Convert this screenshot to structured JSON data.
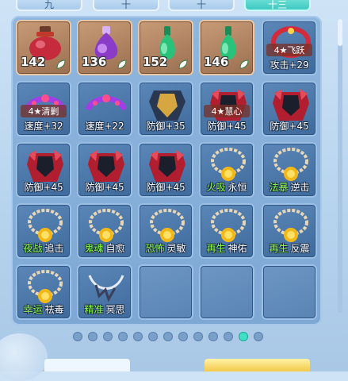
{
  "tabs": [
    {
      "label": "九",
      "active": false
    },
    {
      "label": "十",
      "active": false
    },
    {
      "label": "十",
      "active": false
    },
    {
      "label": "十三",
      "active": true
    }
  ],
  "row1": [
    {
      "kind": "consumable",
      "icon": "red-potion-jar-icon",
      "qty": "142"
    },
    {
      "kind": "consumable",
      "icon": "purple-potion-flask-icon",
      "qty": "136"
    },
    {
      "kind": "consumable",
      "icon": "green-bottle-icon",
      "qty": "152"
    },
    {
      "kind": "consumable",
      "icon": "green-bottle-icon",
      "qty": "146"
    },
    {
      "kind": "equip",
      "icon": "red-necklace-icon",
      "badge": "4★飞跃",
      "stat": "攻击+29"
    }
  ],
  "row2": [
    {
      "kind": "equip",
      "icon": "purple-crown-icon",
      "badge": "4★清剿",
      "stat": "速度+32"
    },
    {
      "kind": "equip",
      "icon": "purple-crown-icon",
      "badge": "",
      "stat": "速度+22"
    },
    {
      "kind": "equip",
      "icon": "dark-armor-icon",
      "badge": "",
      "stat": "防御+35"
    },
    {
      "kind": "equip",
      "icon": "red-armor-icon",
      "badge": "4★慧心",
      "stat": "防御+45"
    },
    {
      "kind": "equip",
      "icon": "red-armor-icon",
      "badge": "",
      "stat": "防御+45"
    }
  ],
  "row3": [
    {
      "kind": "equip",
      "icon": "red-armor-icon",
      "stat": "防御+45"
    },
    {
      "kind": "equip",
      "icon": "red-armor-icon",
      "stat": "防御+45"
    },
    {
      "kind": "equip",
      "icon": "red-armor-icon",
      "stat": "防御+45"
    },
    {
      "kind": "charm",
      "icon": "bead-necklace-icon",
      "k": "火吸",
      "v": "永恒"
    },
    {
      "kind": "charm",
      "icon": "bead-necklace-icon",
      "k": "法暴",
      "v": "逆击"
    }
  ],
  "row4": [
    {
      "kind": "charm",
      "icon": "bead-necklace-icon",
      "k": "夜战",
      "v": "追击"
    },
    {
      "kind": "charm",
      "icon": "bead-necklace-icon",
      "k": "鬼魂",
      "v": "自愈"
    },
    {
      "kind": "charm",
      "icon": "bead-necklace-icon",
      "k": "恐怖",
      "v": "灵敏"
    },
    {
      "kind": "charm",
      "icon": "bead-necklace-icon",
      "k": "再生",
      "v": "神佑"
    },
    {
      "kind": "charm",
      "icon": "bead-necklace-icon",
      "k": "再生",
      "v": "反震"
    }
  ],
  "row5": [
    {
      "kind": "charm",
      "icon": "bead-necklace-icon",
      "k": "幸运",
      "v": "祛毒"
    },
    {
      "kind": "charm",
      "icon": "silver-necklace-icon",
      "k": "精准",
      "v": "冥思"
    },
    {
      "kind": "empty"
    },
    {
      "kind": "empty"
    },
    {
      "kind": "empty"
    }
  ],
  "pager": {
    "total": 13,
    "active_index": 11
  },
  "colors": {
    "accent": "#3fe0c4",
    "skill_green": "#8cff3f"
  }
}
